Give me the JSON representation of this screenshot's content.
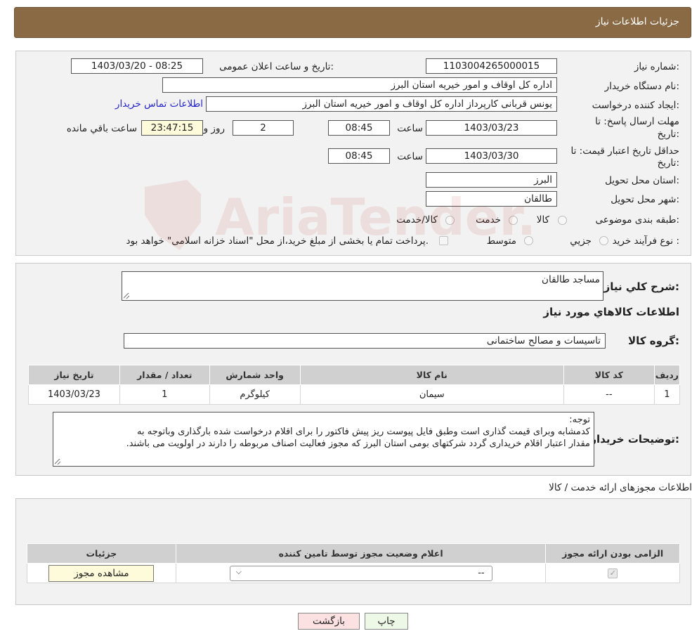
{
  "header": {
    "title": "جزئیات اطلاعات نیاز"
  },
  "form": {
    "need_number_label": "شماره نیاز:",
    "need_number": "1103004265000015",
    "announce_label": "تاریخ و ساعت اعلان عمومی:",
    "announce_value": "1403/03/20 - 08:25",
    "buyer_org_label": "نام دستگاه خریدار:",
    "buyer_org": "اداره کل اوقاف و امور خیریه استان البرز",
    "creator_label": "ایجاد کننده درخواست:",
    "creator": "یونس قربانی کارپرداز اداره کل اوقاف و امور خیریه استان البرز",
    "buyer_contact_link": "اطلاعات تماس خریدار",
    "deadline_label_1": "مهلت ارسال پاسخ: تا",
    "deadline_label_2": "تاریخ:",
    "deadline_date": "1403/03/23",
    "time_label": "ساعت",
    "deadline_time": "08:45",
    "days_value": "2",
    "days_label": "روز و",
    "remaining_time": "23:47:15",
    "remaining_label": "ساعت باقي مانده",
    "validity_label_1": "حداقل تاریخ اعتبار قیمت: تا",
    "validity_label_2": "تاریخ:",
    "validity_date": "1403/03/30",
    "validity_time": "08:45",
    "province_label": "استان محل تحویل:",
    "province": "البرز",
    "city_label": "شهر محل تحویل:",
    "city": "طالقان",
    "category_label": "طبقه بندی موضوعی:",
    "category_options": [
      "کالا",
      "خدمت",
      "کالا/خدمت"
    ],
    "process_label": "نوع فرآیند خرید :",
    "process_options": [
      "جزيي",
      "متوسط"
    ],
    "process_note": "پرداخت تمام یا بخشی از مبلغ خرید،از محل \"اسناد خزانه اسلامی\" خواهد بود."
  },
  "description": {
    "summary_label": "شرح کلي نياز:",
    "summary_value": "مساجد طالقان",
    "goods_title": "اطلاعات کالاهاي مورد نياز",
    "group_label": "گروه کالا:",
    "group_value": "تاسیسات و مصالح ساختمانی",
    "table": {
      "headers": [
        "رديف",
        "کد کالا",
        "نام کالا",
        "واحد شمارش",
        "تعداد / مقدار",
        "تاریخ نیاز"
      ],
      "rows": [
        [
          "1",
          "--",
          "سیمان",
          "کیلوگرم",
          "1",
          "1403/03/23"
        ]
      ]
    },
    "buyer_notes_label": "توضیحات خریدار:",
    "buyer_notes_lines": [
      "توجه:",
      "کدمشابه وبرای قیمت گذاری است وطبق فایل پیوست ریز پیش فاکتور را برای اقلام درخواست شده بارگذاری وباتوجه به",
      "مقدار اعتبار اقلام خریداری گردد شرکتهای بومی استان البرز که مجوز فعالیت اصناف مربوطه را دارند در اولویت می باشند."
    ]
  },
  "permits": {
    "section_title": "اطلاعات مجوزهای ارائه خدمت / کالا",
    "headers": [
      "الزامی بودن ارائه مجوز",
      "اعلام وضعیت مجوز توسط تامین کننده",
      "جزئیات"
    ],
    "select_value": "--",
    "view_button": "مشاهده مجوز"
  },
  "buttons": {
    "print": "چاپ",
    "back": "بازگشت"
  },
  "watermark": {
    "text": "AriaTender.neT",
    "color": "#c0392b"
  },
  "colors": {
    "header_bg": "#8a6a44",
    "highlight_field": "#fdfbd9",
    "link": "#2424c8",
    "print_btn": "#eef8e6",
    "back_btn": "#fbe1e1"
  }
}
